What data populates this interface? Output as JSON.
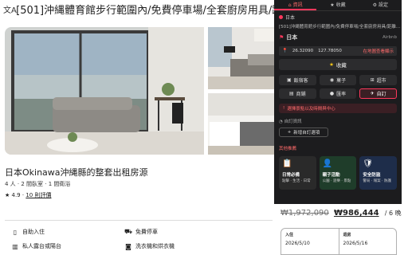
{
  "page": {
    "title_icon": "translate-icon",
    "title": "[501]沖縄體育館步行範圍內/免費停車場/全套廚房用具/距離沖"
  },
  "listing": {
    "title": "日本Okinawa沖縄縣的整套出租房源",
    "subtitle": "4 人 · 2 間臥室 · 1 間衛浴",
    "rating": "★ 4.9 ·",
    "reviews": "10 則評價",
    "amenities": [
      {
        "icon": "door-icon",
        "label": "自助入住"
      },
      {
        "icon": "car-icon",
        "label": "免費停車"
      },
      {
        "icon": "balcony-icon",
        "label": "私人露台或陽台"
      },
      {
        "icon": "washer-icon",
        "label": "洗衣機和烘衣機"
      }
    ]
  },
  "booking": {
    "old_price": "₩1,972,090",
    "new_price": "₩986,444",
    "nights": "/ 6 晚",
    "checkin_label": "入住",
    "checkin_value": "2026/5/10",
    "checkout_label": "退房",
    "checkout_value": "2026/5/16"
  },
  "panel": {
    "tabs": [
      {
        "label": "資訊",
        "icon": "home-icon",
        "active": true
      },
      {
        "label": "收藏",
        "icon": "star-icon",
        "active": false
      },
      {
        "label": "設定",
        "icon": "gear-icon",
        "active": false
      }
    ],
    "country_top": "日本",
    "listing_title": "[501]沖縄體育館步行範圍內/免費停車場/全套廚房用具/距離...",
    "country_main": "日本",
    "source": "Airbnb",
    "lat": "26.32090",
    "lng": "127.78050",
    "map_link": "在地圖查看顯示",
    "favorite": "收藏",
    "buttons": [
      {
        "icon": "building-icon",
        "label": "飯宿客",
        "red": false
      },
      {
        "icon": "food-icon",
        "label": "菓子",
        "red": false
      },
      {
        "icon": "cart-icon",
        "label": "超市",
        "red": false
      },
      {
        "icon": "store-icon",
        "label": "商鋪",
        "red": false
      },
      {
        "icon": "coin-icon",
        "label": "匯率",
        "red": false
      },
      {
        "icon": "plane-icon",
        "label": "自訂",
        "red": true
      }
    ],
    "alert": "選擇景點以及時間與中心",
    "auto_label": "自訂資訊",
    "open_button": "新增自訂選項",
    "recommend_label": "其他推薦",
    "cards": [
      {
        "icon": "clipboard-icon",
        "title": "日常必備",
        "sub": "點擊 · 生活 · 日常"
      },
      {
        "icon": "person-icon",
        "title": "親子活動",
        "sub": "公園 · 遊樂 · 景點"
      },
      {
        "icon": "shield-icon",
        "title": "安全防盜",
        "sub": "警局 · 報案 · 防護"
      }
    ]
  },
  "colors": {
    "accent": "#ff385c",
    "panel_bg": "#1c1c1e",
    "card_green": "#1f3d2a",
    "card_blue": "#1e2d4a"
  }
}
